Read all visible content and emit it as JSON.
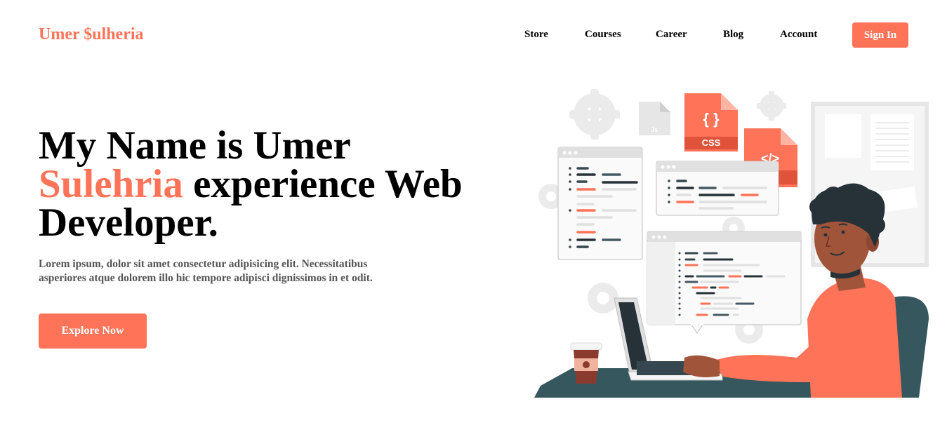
{
  "header": {
    "logo": "Umer $ulheria",
    "nav": [
      {
        "label": "Store"
      },
      {
        "label": "Courses"
      },
      {
        "label": "Career"
      },
      {
        "label": "Blog"
      },
      {
        "label": "Account"
      }
    ],
    "signin_label": "Sign In"
  },
  "hero": {
    "title_part1": "My Name is Umer",
    "title_accent": "Sulehria",
    "title_part2": " experience Web Developer.",
    "description": "Lorem ipsum, dolor sit amet consectetur adipisicing elit. Necessitatibus asperiores atque dolorem illo hic tempore adipisci dignissimos in et odit.",
    "cta_label": "Explore Now"
  },
  "illustration": {
    "file_icons": [
      {
        "label": "Js"
      },
      {
        "label": "CSS"
      },
      {
        "label": "</>"
      }
    ],
    "colors": {
      "accent": "#ff7358",
      "dark": "#37474f",
      "skin": "#a0553b",
      "hair": "#263238"
    }
  }
}
